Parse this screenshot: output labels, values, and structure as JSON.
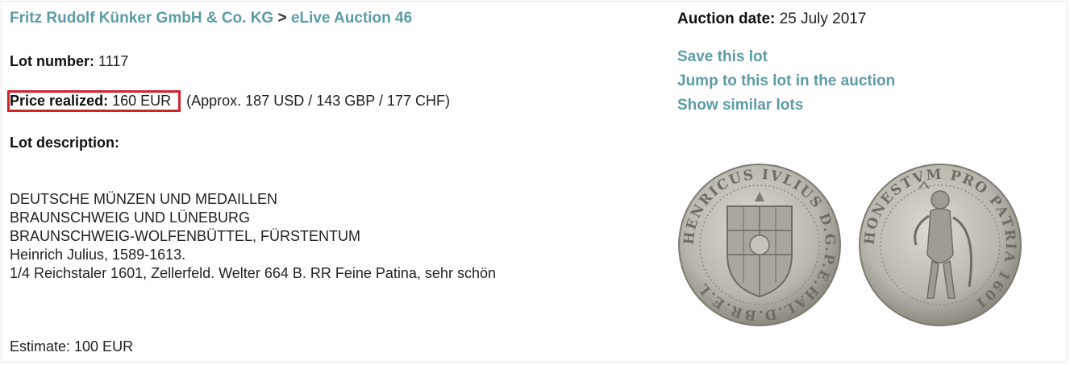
{
  "breadcrumb": {
    "company": "Fritz Rudolf Künker GmbH & Co. KG",
    "separator": ">",
    "auction": "eLive Auction 46"
  },
  "lot": {
    "number_label": "Lot number:",
    "number": "1117",
    "price_label": "Price realized:",
    "price": "160 EUR",
    "price_approx": "(Approx. 187 USD / 143 GBP / 177 CHF)",
    "description_label": "Lot description:",
    "description_lines": [
      "DEUTSCHE MÜNZEN UND MEDAILLEN",
      "BRAUNSCHWEIG UND LÜNEBURG",
      "BRAUNSCHWEIG-WOLFENBÜTTEL, FÜRSTENTUM",
      "Heinrich Julius, 1589-1613.",
      "1/4 Reichstaler 1601, Zellerfeld. Welter 664 B. RR Feine Patina, sehr schön"
    ],
    "estimate": "Estimate: 100 EUR"
  },
  "auction_date": {
    "label": "Auction date:",
    "value": "25 July 2017"
  },
  "actions": {
    "save": "Save this lot",
    "jump": "Jump to this lot in the auction",
    "similar": "Show similar lots"
  },
  "coin_images": {
    "obverse_legend": "HENRICUS IVLIUS D.G.P.E.HAL.D.BR.E.L",
    "reverse_legend": "HONESTVM PRO PATRIA 1601",
    "metal_color": "#b9b6ad",
    "accent_color": "#d0232a",
    "link_color": "#5b9ca6"
  }
}
